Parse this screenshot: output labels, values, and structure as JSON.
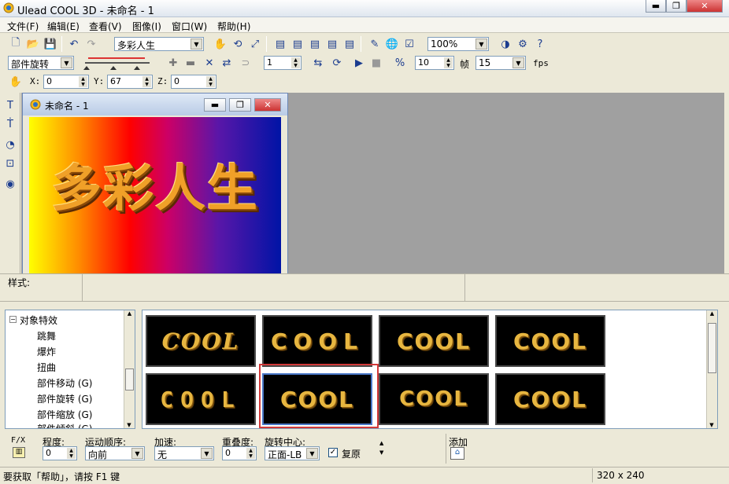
{
  "window": {
    "title": "Ulead COOL 3D - 未命名 - 1"
  },
  "menu": [
    "文件(F)",
    "编辑(E)",
    "查看(V)",
    "图像(I)",
    "窗口(W)",
    "帮助(H)"
  ],
  "toolbar1": {
    "text_combo": "多彩人生",
    "zoom_combo": "100%"
  },
  "toolbar2": {
    "effect_combo": "部件旋转",
    "frame_value": "1",
    "frames_value": "10",
    "frames_label": "帧",
    "fps_value": "15",
    "fps_label": "fps"
  },
  "toolbar3": {
    "x_label": "X:",
    "x_value": "0",
    "y_label": "Y:",
    "y_value": "67",
    "z_label": "Z:",
    "z_value": "0"
  },
  "document": {
    "title": "未命名 - 1",
    "canvas_text": "多彩人生"
  },
  "style_bar": {
    "label": "样式:"
  },
  "tree": {
    "root": "对象特效",
    "items": [
      "跳舞",
      "爆炸",
      "扭曲",
      "部件移动 (G)",
      "部件旋转 (G)",
      "部件缩放 (G)",
      "部件倾斜 (G)"
    ]
  },
  "thumbnails": [
    {
      "text": "COOL",
      "style": "curvy"
    },
    {
      "text": "COOL",
      "style": "spaced"
    },
    {
      "text": "COOL",
      "style": "tilt-c"
    },
    {
      "text": "COOL",
      "style": "tilt-l"
    },
    {
      "text": "COOL",
      "style": "narrow"
    },
    {
      "text": "COOL",
      "style": "selected"
    },
    {
      "text": "COOL",
      "style": "flat"
    },
    {
      "text": "COOL",
      "style": "floating-o"
    }
  ],
  "params": {
    "fx_label": "F/X",
    "degree_label": "程度:",
    "degree_value": "0",
    "order_label": "运动顺序:",
    "order_value": "向前",
    "accel_label": "加速:",
    "accel_value": "无",
    "overlap_label": "重叠度:",
    "overlap_value": "0",
    "center_label": "旋转中心:",
    "center_value": "正面-LB",
    "restore_label": "复原",
    "add_label": "添加"
  },
  "status": {
    "help": "要获取「帮助」，请按 F1 键",
    "size": "320 x 240"
  },
  "colors": {
    "selection": "#d23a3a",
    "thumb_text": "#e7b640"
  }
}
